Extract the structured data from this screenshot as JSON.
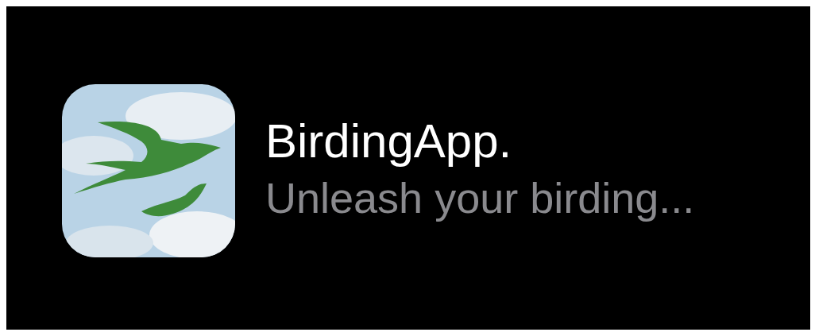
{
  "app": {
    "name": "BirdingApp.",
    "tagline": "Unleash your birding..."
  }
}
